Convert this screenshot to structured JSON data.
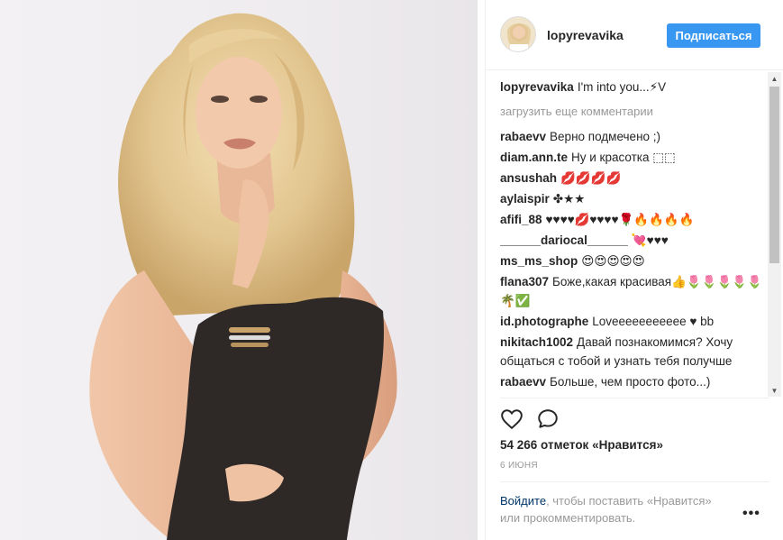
{
  "post": {
    "author": "lopyrevavika",
    "follow_label": "Подписаться",
    "caption_user": "lopyrevavika",
    "caption_text": "I'm into you...⚡V",
    "load_more": "загрузить еще комментарии",
    "comments": [
      {
        "user": "rabaevv",
        "text": "Верно подмечено ;)"
      },
      {
        "user": "diam.ann.te",
        "text": "Ну и красотка ⬚⬚"
      },
      {
        "user": "ansushah",
        "text": "💋💋💋💋"
      },
      {
        "user": "aylaispir",
        "text": "✤★★"
      },
      {
        "user": "afifi_88",
        "text": "♥♥♥♥💋♥♥♥♥🌹🔥🔥🔥🔥"
      },
      {
        "user": "______dariocal______",
        "text": "💘♥♥♥"
      },
      {
        "user": "ms_ms_shop",
        "text": "😍😍😍😍😍"
      },
      {
        "user": "flana307",
        "text": "Боже,какая красивая👍🌷🌷🌷🌷🌷🌴✅"
      },
      {
        "user": "id.photographe",
        "text": "Loveeeeeeeeeee ♥ bb"
      },
      {
        "user": "nikitach1002",
        "text": "Давай познакомимся? Хочу общаться с тобой и узнать тебя получше"
      },
      {
        "user": "rabaevv",
        "text": "Больше, чем просто фото...)"
      }
    ],
    "likes": "54 266 отметок «Нравится»",
    "date": "6 ИЮНЯ",
    "login_link": "Войдите",
    "login_rest": ", чтобы поставить «Нравится» или прокомментировать.",
    "more_options": "•••"
  },
  "icons": {
    "like": "heart-outline-icon",
    "comment": "speech-bubble-icon",
    "scroll_up": "triangle-up-icon",
    "scroll_down": "triangle-down-icon"
  },
  "colors": {
    "accent": "#3897f0",
    "link": "#003569",
    "muted": "#999999"
  }
}
